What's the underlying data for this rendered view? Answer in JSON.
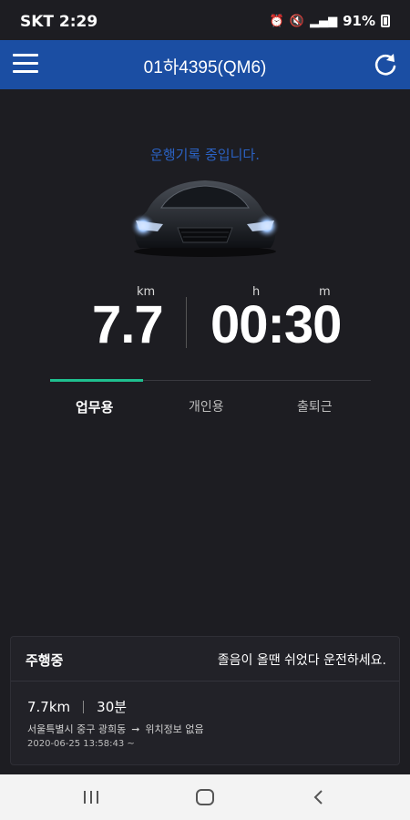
{
  "status_bar": {
    "carrier": "SKT 2:29",
    "battery": "91%"
  },
  "app_bar": {
    "title": "01하4395(QM6)",
    "menu_icon": "hamburger-menu-icon",
    "refresh_icon": "refresh-icon"
  },
  "driving": {
    "status_message": "운행기록 중입니다.",
    "distance_value": "7.7",
    "distance_unit": "km",
    "time_value": "00:30",
    "hour_unit": "h",
    "minute_unit": "m"
  },
  "tabs": [
    {
      "label": "업무용",
      "active": true
    },
    {
      "label": "개인용",
      "active": false
    },
    {
      "label": "출퇴근",
      "active": false
    }
  ],
  "trip_panel": {
    "title": "주행중",
    "notice": "졸음이 올땐 쉬었다 운전하세요.",
    "distance": "7.7km",
    "duration": "30분",
    "origin": "서울특별시 중구 광희동",
    "destination": "위치정보 없음",
    "start_time": "2020-06-25 13:58:43 ~"
  },
  "colors": {
    "app_bar": "#1b4ea3",
    "status_message": "#2b62c4",
    "tab_indicator": "#1fbf8f",
    "background": "#1d1d22"
  }
}
